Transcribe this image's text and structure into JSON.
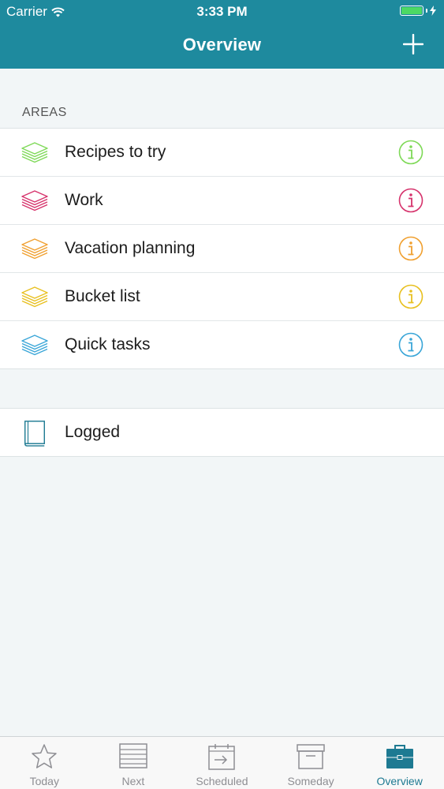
{
  "status_bar": {
    "carrier": "Carrier",
    "time": "3:33 PM"
  },
  "nav": {
    "title": "Overview",
    "add_icon": "plus-icon"
  },
  "areas": {
    "section_label": "AREAS",
    "items": [
      {
        "label": "Recipes to try",
        "color": "#7ed957",
        "icon": "stack-icon"
      },
      {
        "label": "Work",
        "color": "#d6336c",
        "icon": "stack-icon"
      },
      {
        "label": "Vacation planning",
        "color": "#f0a030",
        "icon": "stack-icon"
      },
      {
        "label": "Bucket list",
        "color": "#e8c020",
        "icon": "stack-icon"
      },
      {
        "label": "Quick tasks",
        "color": "#3aa6d8",
        "icon": "stack-icon"
      }
    ]
  },
  "logged": {
    "label": "Logged",
    "icon": "book-icon",
    "color": "#1e7a92"
  },
  "tabbar": {
    "tabs": [
      {
        "label": "Today",
        "icon": "star-icon",
        "active": false
      },
      {
        "label": "Next",
        "icon": "list-icon",
        "active": false
      },
      {
        "label": "Scheduled",
        "icon": "calendar-icon",
        "active": false
      },
      {
        "label": "Someday",
        "icon": "archive-icon",
        "active": false
      },
      {
        "label": "Overview",
        "icon": "briefcase-icon",
        "active": true
      }
    ],
    "active_color": "#1e7a92",
    "inactive_color": "#8e8e93"
  },
  "colors": {
    "header": "#1e8a9e",
    "background": "#f2f6f7"
  }
}
